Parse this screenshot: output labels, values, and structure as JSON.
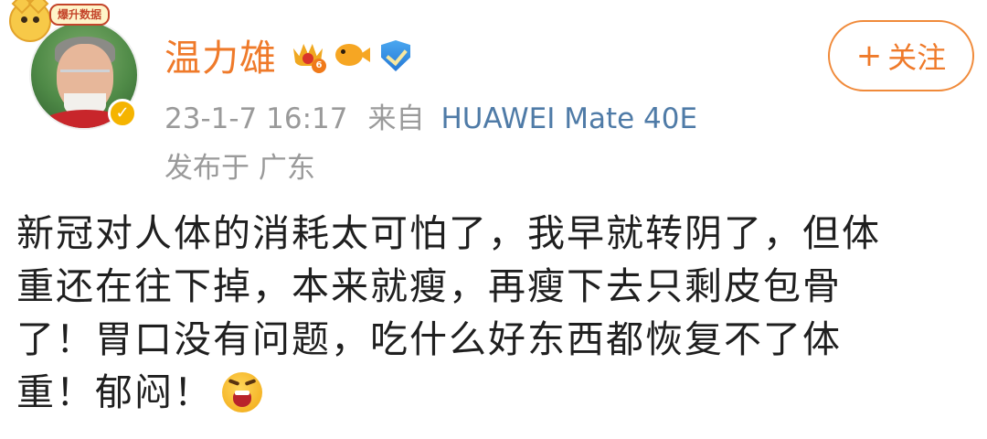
{
  "user": {
    "name": "温力雄",
    "avatar_frame_tag": "爆升数据",
    "verified_icon": "verified-v-icon",
    "crown_level": "6",
    "badges": [
      "crown-badge-icon",
      "fish-badge-icon",
      "shield-badge-icon"
    ]
  },
  "post_meta": {
    "timestamp": "23-1-7 16:17",
    "source_prefix": "来自",
    "device": "HUAWEI Mate 40E",
    "location": "发布于 广东"
  },
  "follow_button": {
    "plus": "+",
    "label": "关注"
  },
  "post": {
    "lines": [
      "新冠对人体的消耗太可怕了，我早就转阴了，但体",
      "重还在往下掉，本来就瘦，再瘦下去只剩皮包骨",
      "了！胃口没有问题，吃什么好东西都恢复不了体",
      "重！郁闷！"
    ],
    "emoji": "crying-emoji-icon"
  },
  "colors": {
    "name": "#ef7a2a",
    "device_link": "#4f7ba7",
    "meta_gray": "#9a9a9a",
    "follow_border": "#f08a3a",
    "body_text": "#1f1f1f"
  }
}
